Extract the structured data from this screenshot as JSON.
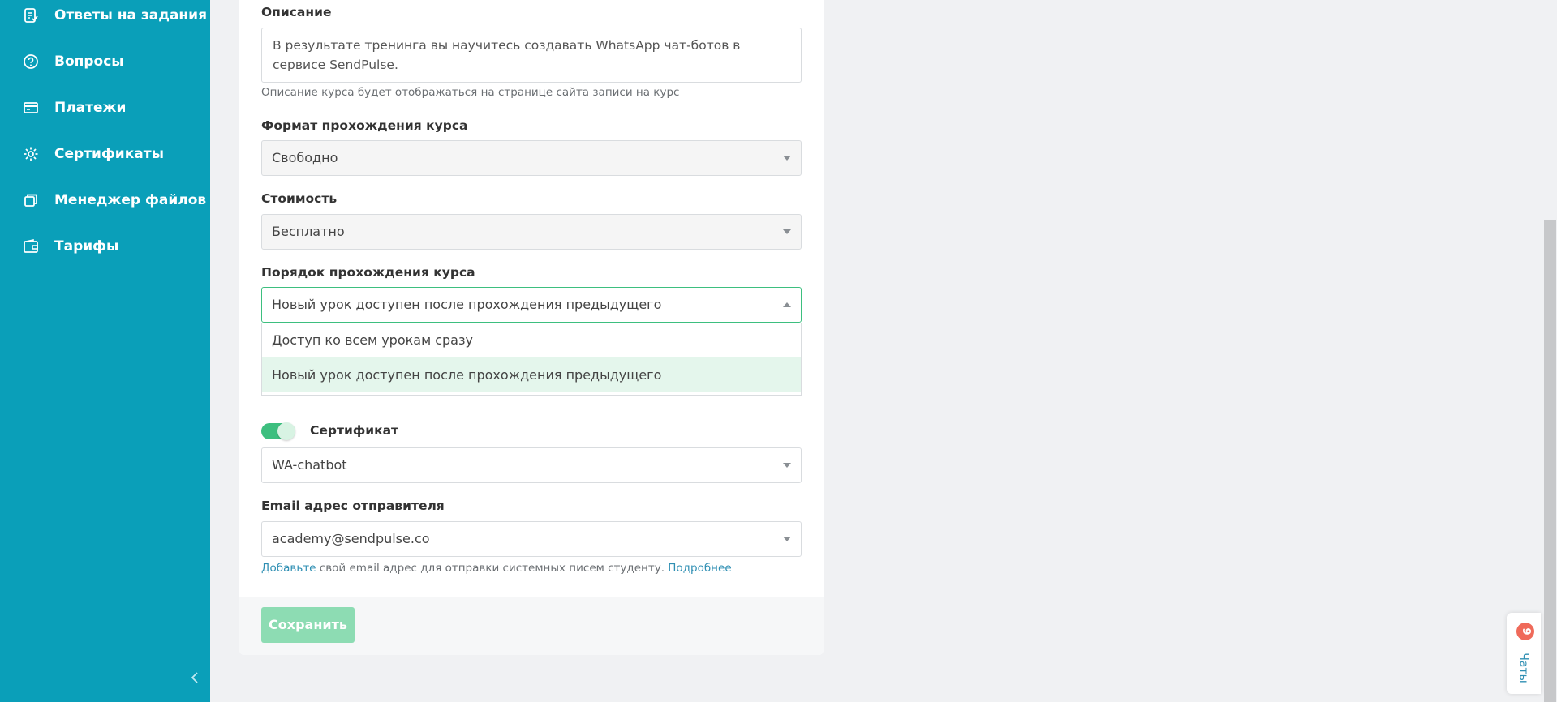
{
  "sidebar": {
    "items": [
      {
        "label": "Ответы на задания",
        "icon": "assignment-answers-icon"
      },
      {
        "label": "Вопросы",
        "icon": "question-icon"
      },
      {
        "label": "Платежи",
        "icon": "payments-icon"
      },
      {
        "label": "Сертификаты",
        "icon": "gear-icon"
      },
      {
        "label": "Менеджер файлов",
        "icon": "files-icon"
      },
      {
        "label": "Тарифы",
        "icon": "wallet-icon"
      }
    ],
    "collapse_icon": "chevron-left-icon"
  },
  "form": {
    "description": {
      "label": "Описание",
      "value": "В результате тренинга вы научитесь создавать WhatsApp чат-ботов в сервисе SendPulse.",
      "hint": "Описание курса будет отображаться на странице сайта записи на курс"
    },
    "format": {
      "label": "Формат прохождения курса",
      "value": "Свободно"
    },
    "price": {
      "label": "Стоимость",
      "value": "Бесплатно"
    },
    "order": {
      "label": "Порядок прохождения курса",
      "value": "Новый урок доступен после прохождения предыдущего",
      "options": [
        "Доступ ко всем урокам сразу",
        "Новый урок доступен после прохождения предыдущего"
      ]
    },
    "certificate": {
      "label": "Сертификат",
      "enabled": true,
      "value": "WA-chatbot"
    },
    "sender_email": {
      "label": "Email адрес отправителя",
      "value": "academy@sendpulse.co",
      "hint_link1": "Добавьте",
      "hint_text": " свой email адрес для отправки системных писем студенту. ",
      "hint_link2": "Подробнее"
    },
    "save_label": "Сохранить"
  },
  "chat_widget": {
    "label": "Чаты",
    "badge": "9"
  },
  "colors": {
    "sidebar": "#0a9fb9",
    "accent_green": "#3dbf7f",
    "save_button_disabled": "#8ddcb3",
    "badge": "#ef6a5a",
    "link": "#2f8fb3"
  }
}
